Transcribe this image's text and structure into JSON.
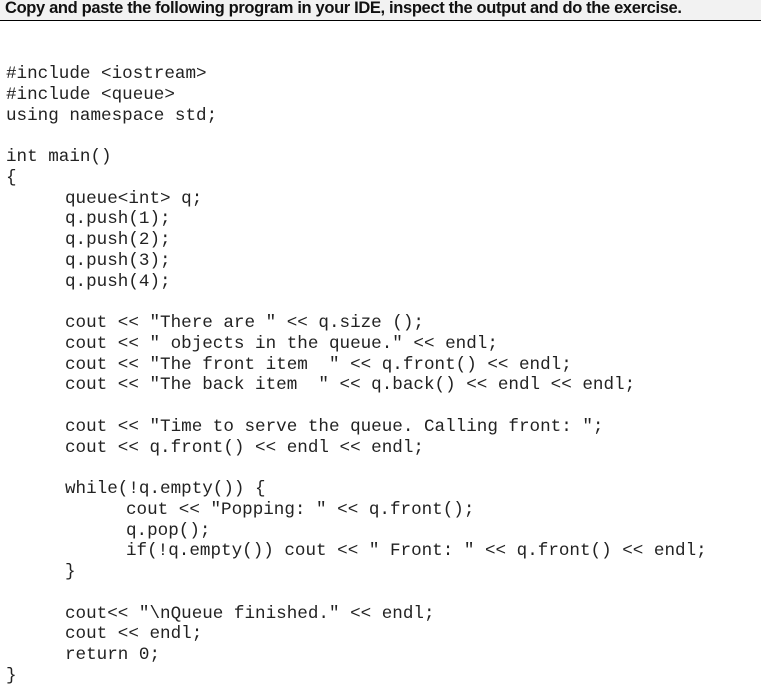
{
  "header": {
    "title": "Copy and paste the following program in your IDE, inspect the output and do the exercise."
  },
  "code": {
    "language": "C++",
    "lines": [
      {
        "indent": 0,
        "text": "#include <iostream>"
      },
      {
        "indent": 0,
        "text": "#include <queue>"
      },
      {
        "indent": 0,
        "text": "using namespace std;"
      },
      {
        "indent": 0,
        "text": ""
      },
      {
        "indent": 0,
        "text": "int main()"
      },
      {
        "indent": 0,
        "text": "{"
      },
      {
        "indent": 1,
        "text": "queue<int> q;"
      },
      {
        "indent": 1,
        "text": "q.push(1);"
      },
      {
        "indent": 1,
        "text": "q.push(2);"
      },
      {
        "indent": 1,
        "text": "q.push(3);"
      },
      {
        "indent": 1,
        "text": "q.push(4);"
      },
      {
        "indent": 0,
        "text": ""
      },
      {
        "indent": 1,
        "text": "cout << \"There are \" << q.size ();"
      },
      {
        "indent": 1,
        "text": "cout << \" objects in the queue.\" << endl;"
      },
      {
        "indent": 1,
        "text": "cout << \"The front item  \" << q.front() << endl;"
      },
      {
        "indent": 1,
        "text": "cout << \"The back item  \" << q.back() << endl << endl;"
      },
      {
        "indent": 0,
        "text": ""
      },
      {
        "indent": 1,
        "text": "cout << \"Time to serve the queue. Calling front: \";"
      },
      {
        "indent": 1,
        "text": "cout << q.front() << endl << endl;"
      },
      {
        "indent": 0,
        "text": ""
      },
      {
        "indent": 1,
        "text": "while(!q.empty()) {"
      },
      {
        "indent": 2,
        "text": "cout << \"Popping: \" << q.front();"
      },
      {
        "indent": 2,
        "text": "q.pop();"
      },
      {
        "indent": 2,
        "text": "if(!q.empty()) cout << \" Front: \" << q.front() << endl;"
      },
      {
        "indent": 1,
        "text": "}"
      },
      {
        "indent": 0,
        "text": ""
      },
      {
        "indent": 1,
        "text": "cout<< \"\\nQueue finished.\" << endl;"
      },
      {
        "indent": 1,
        "text": "cout << endl;"
      },
      {
        "indent": 1,
        "text": "return 0;"
      },
      {
        "indent": 0,
        "text": "}"
      }
    ]
  }
}
